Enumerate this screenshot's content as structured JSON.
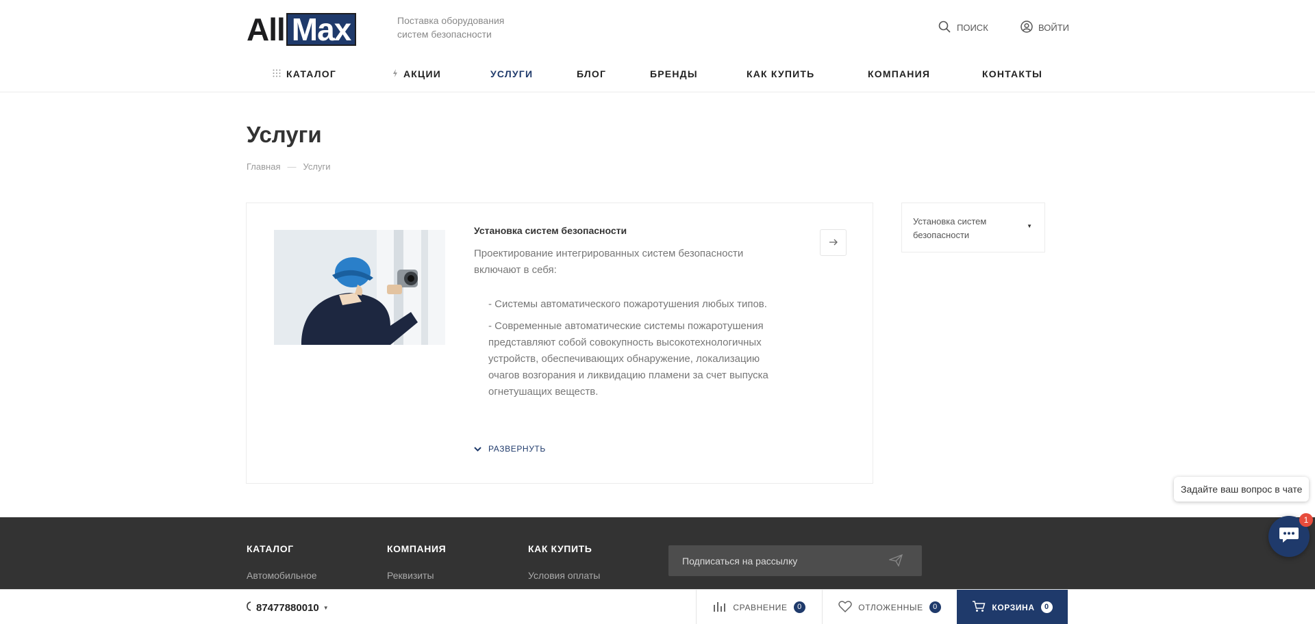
{
  "header": {
    "logo_part1": "All",
    "logo_part2": "Max",
    "slogan": "Поставка оборудования систем безопасности",
    "search_label": "ПОИСК",
    "login_label": "ВОЙТИ"
  },
  "nav": {
    "items": [
      "КАТАЛОГ",
      "АКЦИИ",
      "УСЛУГИ",
      "БЛОГ",
      "БРЕНДЫ",
      "КАК КУПИТЬ",
      "КОМПАНИЯ",
      "КОНТАКТЫ"
    ],
    "active": "УСЛУГИ"
  },
  "page": {
    "title": "Услуги",
    "breadcrumb": [
      "Главная",
      "—",
      "Услуги"
    ]
  },
  "service": {
    "title": "Установка систем безопасности",
    "lead": "Проектирование интегрированных систем безопасности включают в себя:",
    "list": [
      "- Системы автоматического пожаротушения любых типов.",
      "- Современные автоматические системы пожаротушения представляют собой совокупность высокотехнологичных устройств, обеспечивающих обнаружение, локализацию очагов возгорания и ликвидацию пламени за счет выпуска огнетушащих веществ."
    ],
    "expand_label": "РАЗВЕРНУТЬ"
  },
  "sidebar": {
    "filter_label": "Установка систем безопасности"
  },
  "footer": {
    "columns": [
      {
        "heading": "КАТАЛОГ",
        "link": "Автомобильное"
      },
      {
        "heading": "КОМПАНИЯ",
        "link": "Реквизиты"
      },
      {
        "heading": "КАК КУПИТЬ",
        "link": "Условия оплаты"
      }
    ],
    "subscribe_label": "Подписаться на рассылку"
  },
  "chat": {
    "tooltip": "Задайте ваш вопрос в чате",
    "badge": "1"
  },
  "bottom_bar": {
    "phone": "87477880010",
    "compare_label": "СРАВНЕНИЕ",
    "compare_count": "0",
    "favorites_label": "ОТЛОЖЕННЫЕ",
    "favorites_count": "0",
    "cart_label": "КОРЗИНА",
    "cart_count": "0"
  },
  "colors": {
    "brand": "#1f3a6b",
    "footer_bg": "#333333",
    "badge_red": "#e74c3c"
  }
}
